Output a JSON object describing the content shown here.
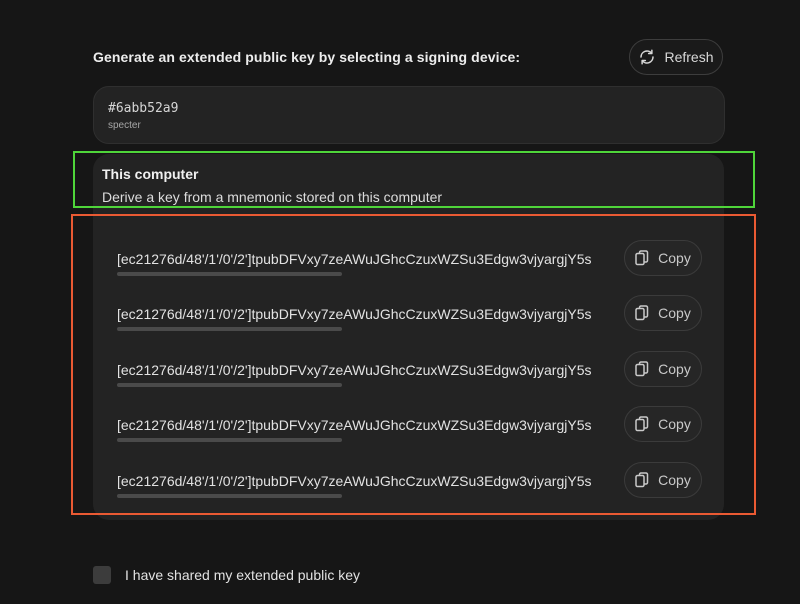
{
  "header": {
    "title": "Generate an extended public key by selecting a signing device:",
    "refresh_label": "Refresh",
    "refresh_icon": "refresh-icon"
  },
  "device": {
    "id": "#6abb52a9",
    "name": "specter"
  },
  "computer_option": {
    "title": "This computer",
    "description": "Derive a key from a mnemonic stored on this computer"
  },
  "keys": [
    {
      "value": "[ec21276d/48'/1'/0'/2']tpubDFVxy7zeAWuJGhcCzuxWZSu3Edgw3vjyargjY5s",
      "copy_label": "Copy"
    },
    {
      "value": "[ec21276d/48'/1'/0'/2']tpubDFVxy7zeAWuJGhcCzuxWZSu3Edgw3vjyargjY5s",
      "copy_label": "Copy"
    },
    {
      "value": "[ec21276d/48'/1'/0'/2']tpubDFVxy7zeAWuJGhcCzuxWZSu3Edgw3vjyargjY5s",
      "copy_label": "Copy"
    },
    {
      "value": "[ec21276d/48'/1'/0'/2']tpubDFVxy7zeAWuJGhcCzuxWZSu3Edgw3vjyargjY5s",
      "copy_label": "Copy"
    },
    {
      "value": "[ec21276d/48'/1'/0'/2']tpubDFVxy7zeAWuJGhcCzuxWZSu3Edgw3vjyargjY5s",
      "copy_label": "Copy"
    }
  ],
  "confirmation": {
    "label": "I have shared my extended public key",
    "checked": false
  },
  "colors": {
    "background": "#161616",
    "card": "#232323",
    "highlight_green": "#4fd53a",
    "highlight_red": "#ea5a33"
  }
}
